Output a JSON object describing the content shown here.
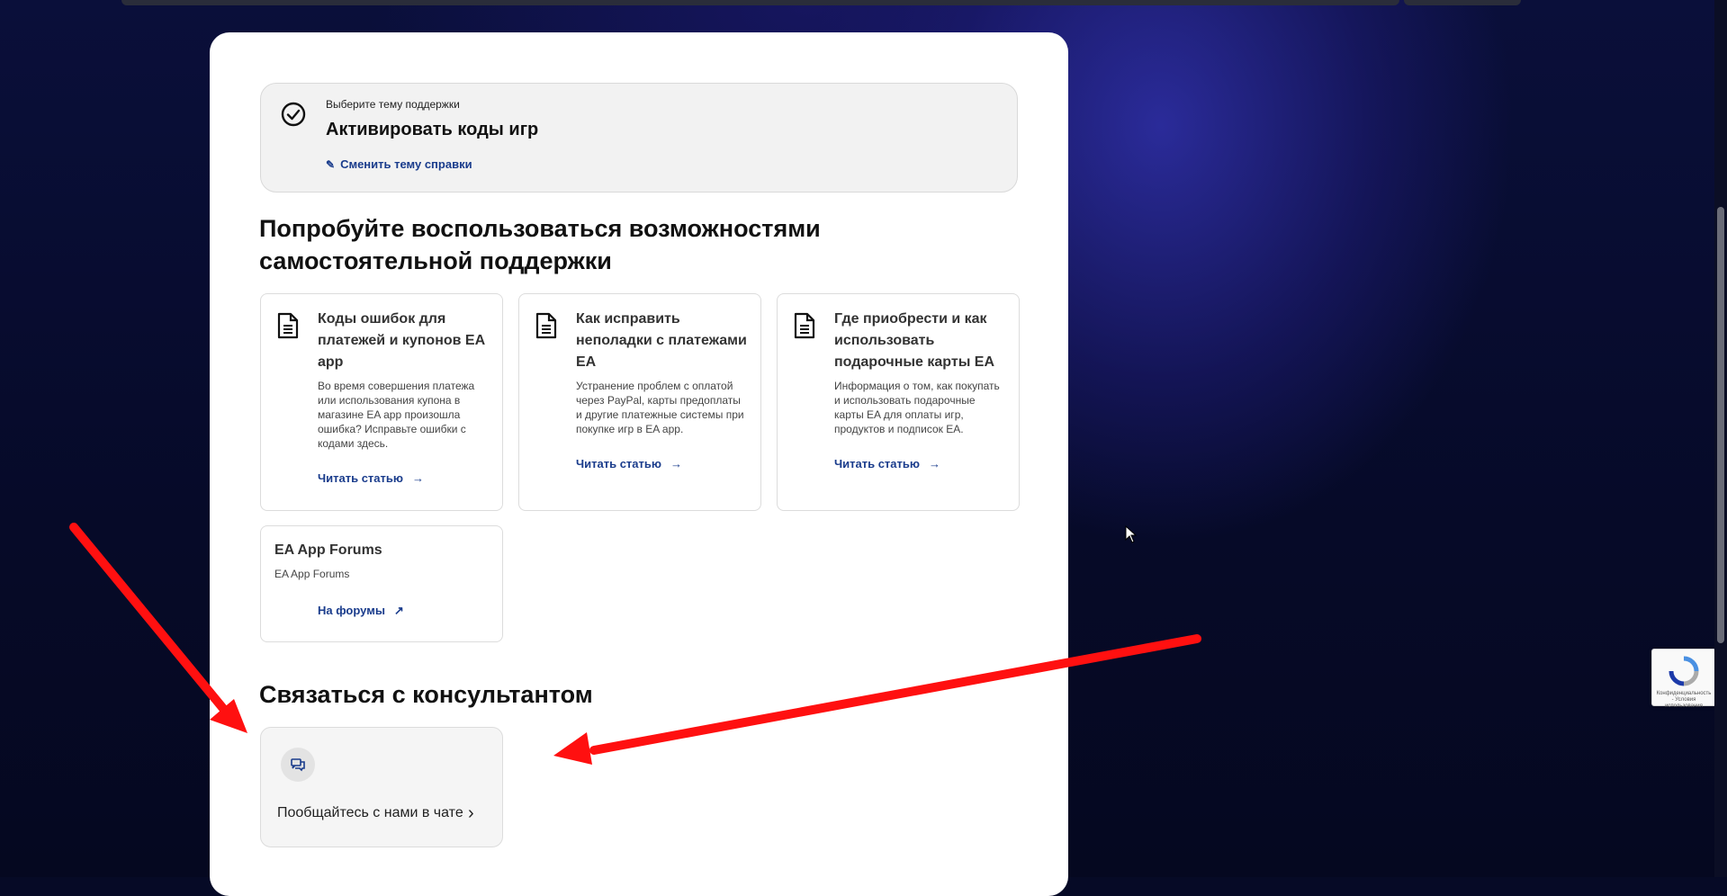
{
  "topic": {
    "caption": "Выберите тему поддержки",
    "title": "Активировать коды игр",
    "change_link": "Сменить тему справки"
  },
  "self_help": {
    "heading": "Попробуйте воспользоваться возможностями самостоятельной поддержки",
    "articles": [
      {
        "title": "Коды ошибок для платежей и купонов EA app",
        "description": "Во время совершения платежа или использования купона в магазине EA app произошла ошибка? Исправьте ошибки с кодами здесь.",
        "link": "Читать статью"
      },
      {
        "title": "Как исправить неполадки с платежами EA",
        "description": "Устранение проблем с оплатой через PayPal, карты предоплаты и другие платежные системы при покупке игр в EA app.",
        "link": "Читать статью"
      },
      {
        "title": "Где приобрести и как использовать подарочные карты EA",
        "description": "Информация о том, как покупать и использовать подарочные карты EA для оплаты игр, продуктов и подписок EA.",
        "link": "Читать статью"
      }
    ],
    "forum": {
      "title": "EA App Forums",
      "subtitle": "EA App Forums",
      "link": "На форумы"
    }
  },
  "contact": {
    "heading": "Связаться с консультантом",
    "chat_label": "Пообщайтесь с нами в чате"
  },
  "recaptcha": {
    "text": "Конфиденциальность - Условия использования"
  },
  "colors": {
    "link": "#1a3c8c",
    "annotation_arrow": "#ff1010",
    "background": "#060a26"
  }
}
